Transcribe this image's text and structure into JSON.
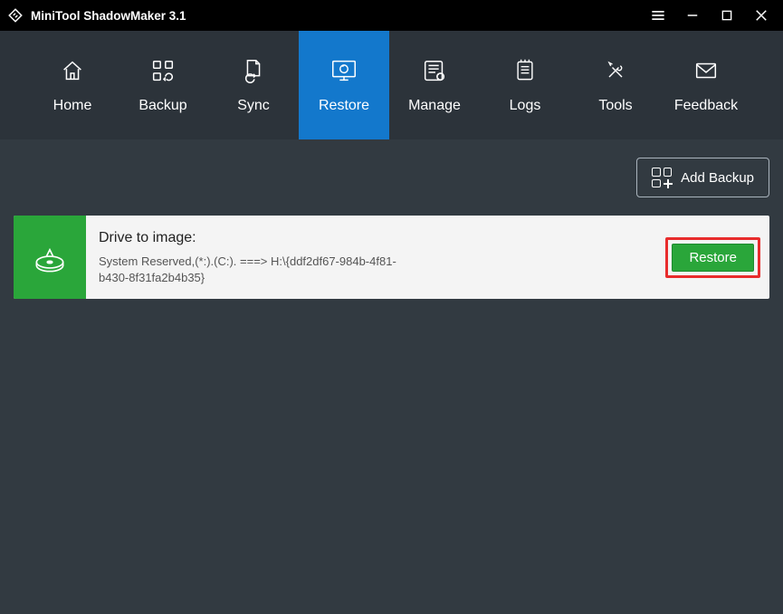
{
  "titlebar": {
    "title": "MiniTool ShadowMaker 3.1"
  },
  "nav": {
    "items": [
      {
        "label": "Home"
      },
      {
        "label": "Backup"
      },
      {
        "label": "Sync"
      },
      {
        "label": "Restore"
      },
      {
        "label": "Manage"
      },
      {
        "label": "Logs"
      },
      {
        "label": "Tools"
      },
      {
        "label": "Feedback"
      }
    ]
  },
  "actions": {
    "add_backup": "Add Backup"
  },
  "task": {
    "title": "Drive to image:",
    "detail": "System Reserved,(*:).(C:). ===> H:\\{ddf2df67-984b-4f81-b430-8f31fa2b4b35}",
    "restore_label": "Restore"
  }
}
